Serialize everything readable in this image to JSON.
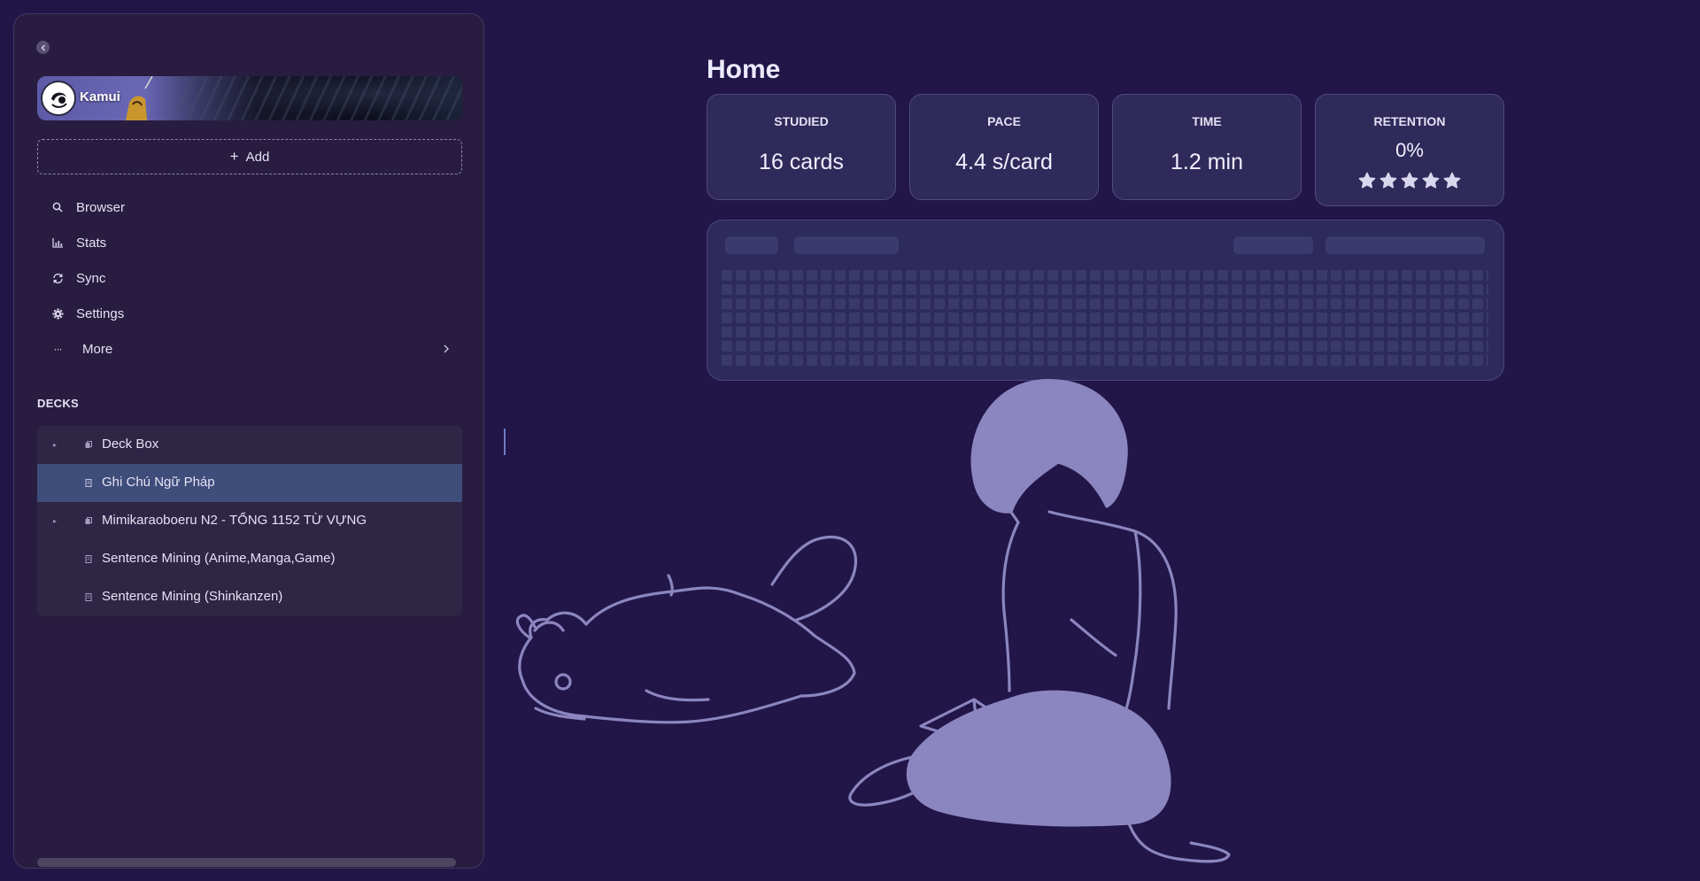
{
  "profile": {
    "name": "Kamui"
  },
  "sidebar": {
    "add_label": "Add",
    "nav": [
      {
        "label": "Browser",
        "icon": "search-icon"
      },
      {
        "label": "Stats",
        "icon": "chart-icon"
      },
      {
        "label": "Sync",
        "icon": "sync-icon"
      },
      {
        "label": "Settings",
        "icon": "gear-icon"
      },
      {
        "label": "More",
        "icon": "more-icon"
      }
    ],
    "decks_heading": "DECKS",
    "decks": [
      {
        "label": "Deck Box",
        "expandable": true,
        "selected": false
      },
      {
        "label": "Ghi Chú Ngữ Pháp",
        "expandable": false,
        "selected": true
      },
      {
        "label": "Mimikaraoboeru N2 - TỔNG 1152 TỪ VỰNG",
        "expandable": true,
        "selected": false
      },
      {
        "label": "Sentence Mining (Anime,Manga,Game)",
        "expandable": false,
        "selected": false
      },
      {
        "label": "Sentence Mining (Shinkanzen)",
        "expandable": false,
        "selected": false
      }
    ]
  },
  "main": {
    "title": "Home",
    "stats": {
      "studied": {
        "label": "STUDIED",
        "value": "16 cards"
      },
      "pace": {
        "label": "PACE",
        "value": "4.4 s/card"
      },
      "time": {
        "label": "TIME",
        "value": "1.2 min"
      },
      "retention": {
        "label": "RETENTION",
        "value": "0%",
        "stars_filled": 5,
        "stars_total": 5
      }
    }
  },
  "colors": {
    "background": "#221548",
    "sidebar": "#281d40",
    "selected_row": "#3e4d7a",
    "card": "#302a5a",
    "illustration": "#8b86bf"
  }
}
